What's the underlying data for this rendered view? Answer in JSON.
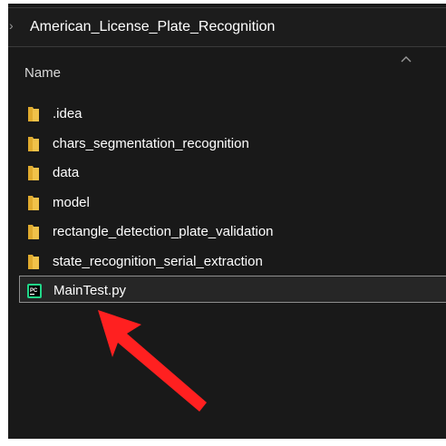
{
  "address_bar": {
    "chevron": "›",
    "path": "American_License_Plate_Recognition"
  },
  "columns": {
    "name_header": "Name",
    "sort_indicator_icon": "chevron-up-icon"
  },
  "items": [
    {
      "label": ".idea",
      "type": "folder"
    },
    {
      "label": "chars_segmentation_recognition",
      "type": "folder"
    },
    {
      "label": "data",
      "type": "folder"
    },
    {
      "label": "model",
      "type": "folder"
    },
    {
      "label": "rectangle_detection_plate_validation",
      "type": "folder"
    },
    {
      "label": "state_recognition_serial_extraction",
      "type": "folder"
    },
    {
      "label": "MainTest.py",
      "type": "pycharm-file",
      "selected": true
    }
  ],
  "colors": {
    "background": "#191919",
    "folder": "#f0c24a",
    "arrow": "#ff2020"
  }
}
